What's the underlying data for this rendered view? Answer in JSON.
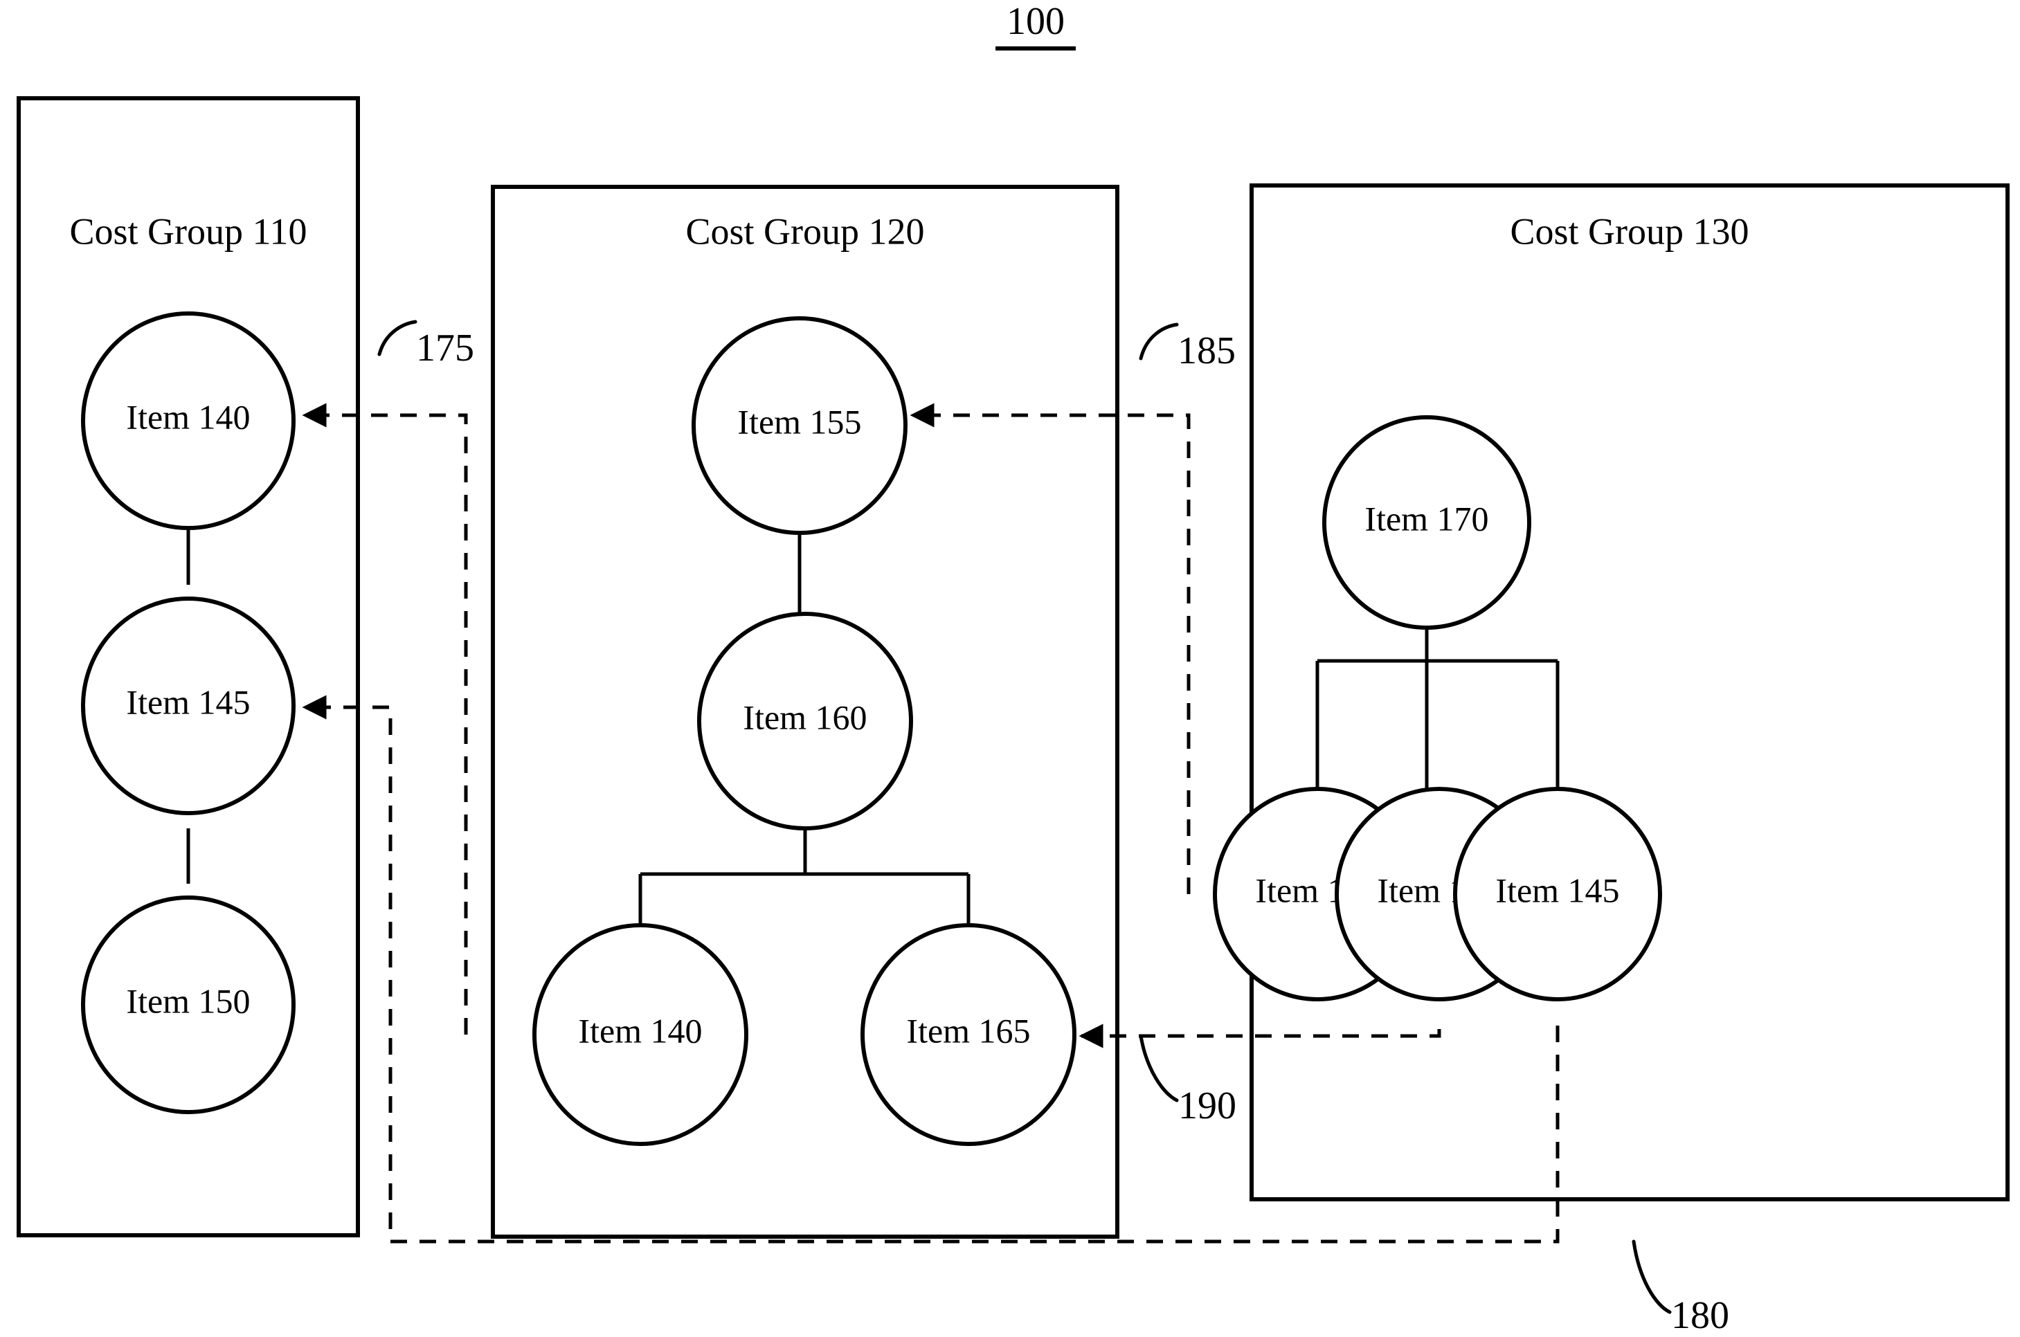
{
  "figure": {
    "number": "100"
  },
  "groups": [
    {
      "id": "110",
      "title": "Cost Group 110",
      "nodes": [
        {
          "label": "Item 140"
        },
        {
          "label": "Item 145"
        },
        {
          "label": "Item 150"
        }
      ]
    },
    {
      "id": "120",
      "title": "Cost Group 120",
      "nodes": [
        {
          "label": "Item 155"
        },
        {
          "label": "Item 160"
        },
        {
          "label": "Item 140"
        },
        {
          "label": "Item 165"
        }
      ]
    },
    {
      "id": "130",
      "title": "Cost Group 130",
      "nodes": [
        {
          "label": "Item 170"
        },
        {
          "label": "Item 155"
        },
        {
          "label": "Item 165"
        },
        {
          "label": "Item 145"
        }
      ]
    }
  ],
  "references": [
    {
      "id": "175",
      "label": "175"
    },
    {
      "id": "185",
      "label": "185"
    },
    {
      "id": "190",
      "label": "190"
    },
    {
      "id": "180",
      "label": "180"
    }
  ],
  "colors": {
    "stroke": "#000000",
    "background": "#ffffff"
  }
}
